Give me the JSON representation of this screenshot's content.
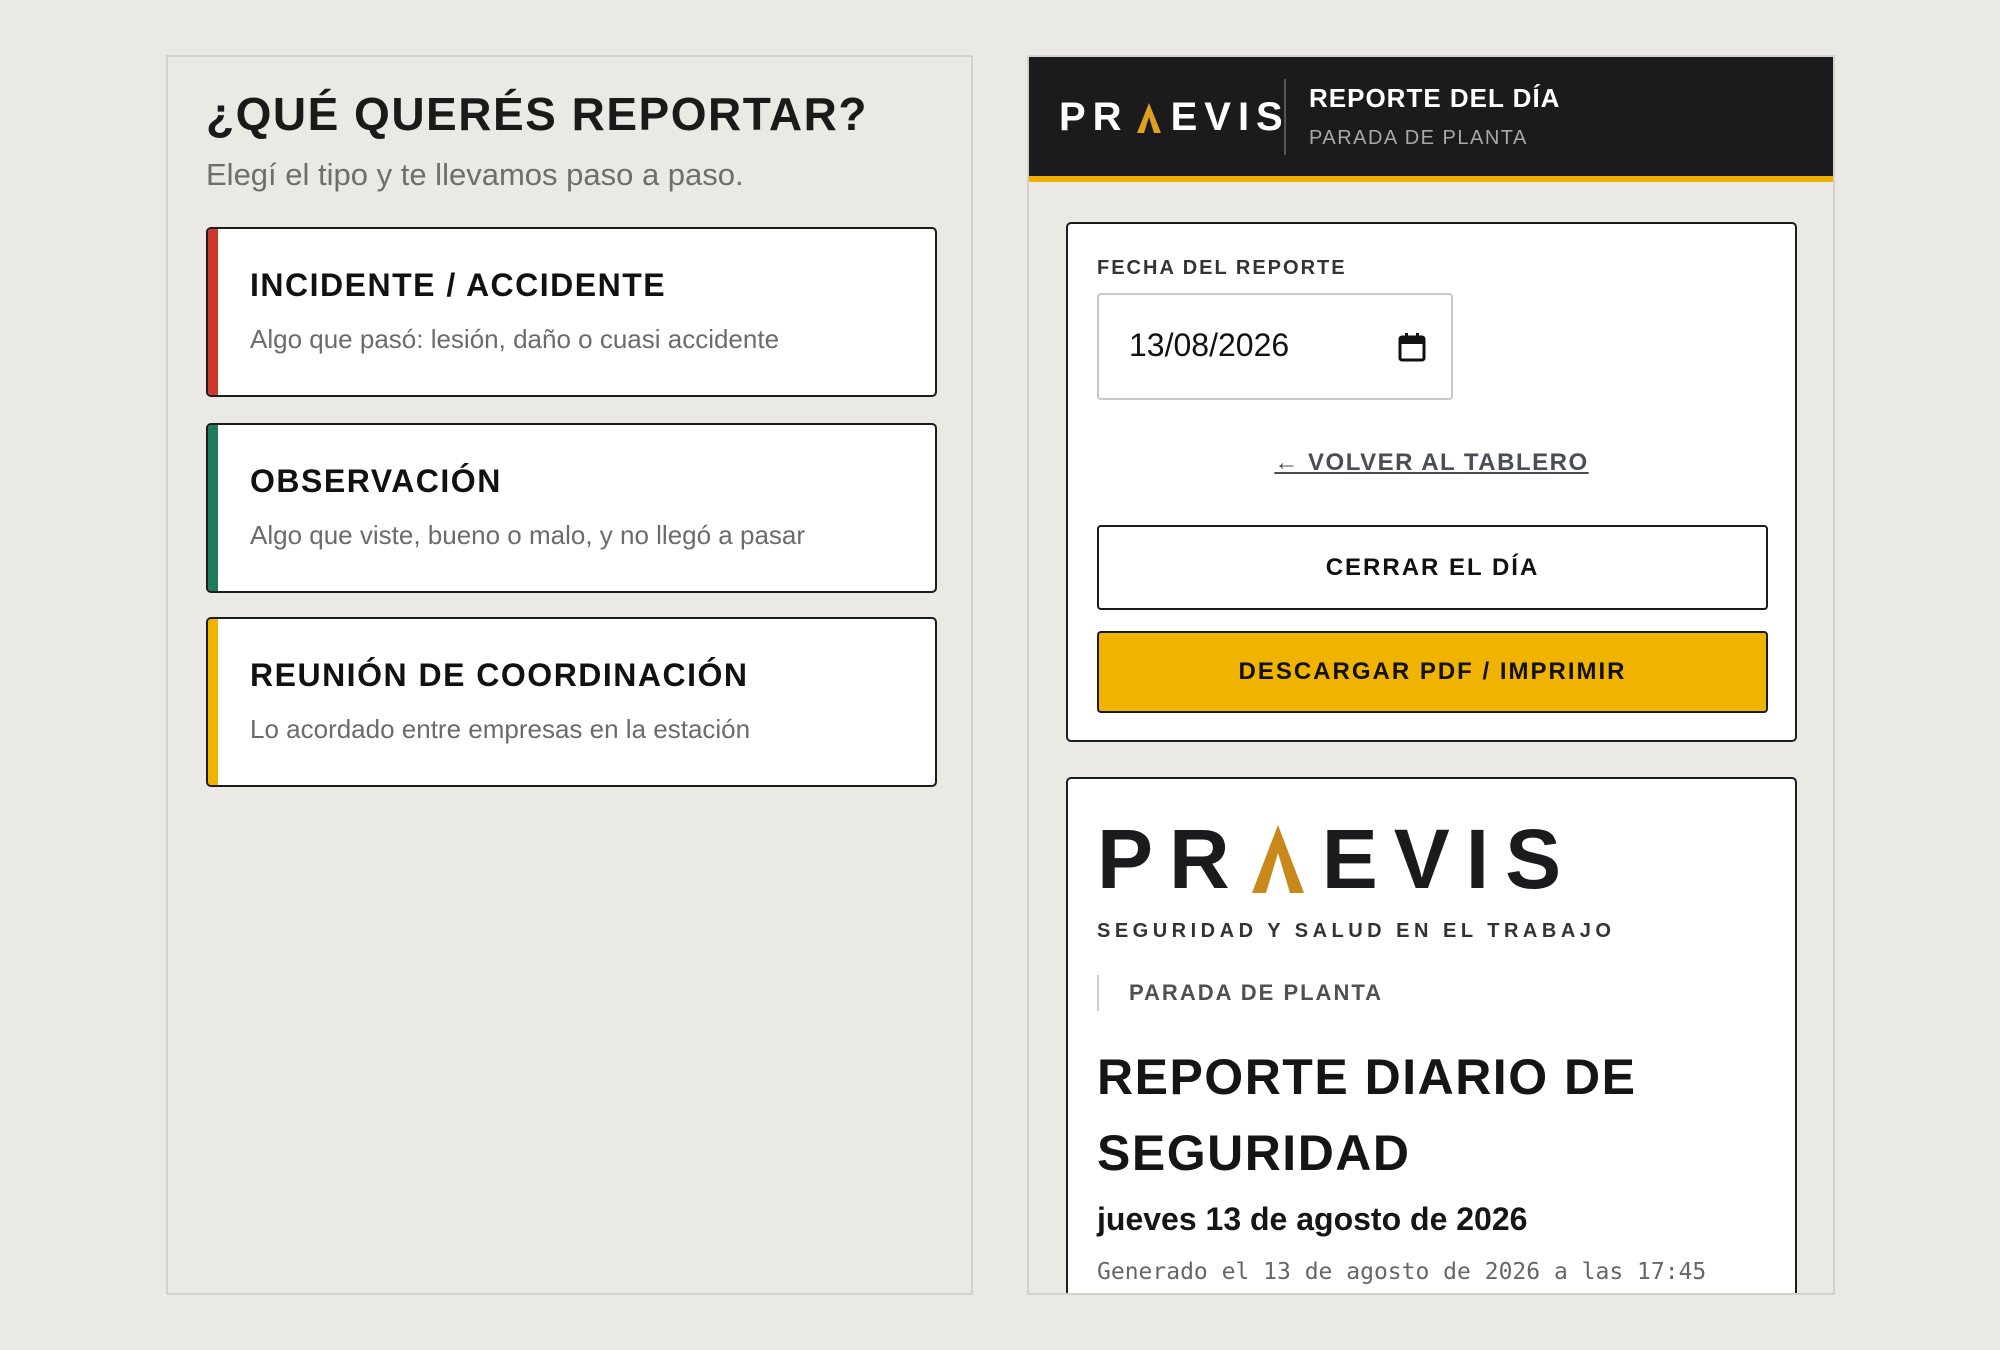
{
  "left": {
    "title": "¿QUÉ QUERÉS REPORTAR?",
    "subtitle": "Elegí el tipo y te llevamos paso a paso.",
    "types": [
      {
        "title": "INCIDENTE / ACCIDENTE",
        "description": "Algo que pasó: lesión, daño o cuasi accidente",
        "color": "#c8392b"
      },
      {
        "title": "OBSERVACIÓN",
        "description": "Algo que viste, bueno o malo, y no llegó a pasar",
        "color": "#1f7a5a"
      },
      {
        "title": "REUNIÓN DE COORDINACIÓN",
        "description": "Lo acordado entre empresas en la estación",
        "color": "#f0b400"
      }
    ]
  },
  "header": {
    "logo_left": "PR",
    "logo_right": "EVIS",
    "title": "REPORTE DEL DÍA",
    "subtitle": "PARADA DE PLANTA",
    "accent": "#f0b400"
  },
  "controls": {
    "date_label": "FECHA DEL REPORTE",
    "date_value": "13/08/2026",
    "back_link": "← VOLVER AL TABLERO",
    "close_button": "CERRAR EL DÍA",
    "pdf_button": "DESCARGAR PDF / IMPRIMIR"
  },
  "report": {
    "logo_left": "PR",
    "logo_right": "EVIS",
    "tagline": "SEGURIDAD Y SALUD EN EL TRABAJO",
    "section": "PARADA DE PLANTA",
    "title": "REPORTE DIARIO DE SEGURIDAD",
    "date": "jueves 13 de agosto de 2026",
    "generated": "Generado el 13 de agosto de 2026 a las 17:45"
  }
}
